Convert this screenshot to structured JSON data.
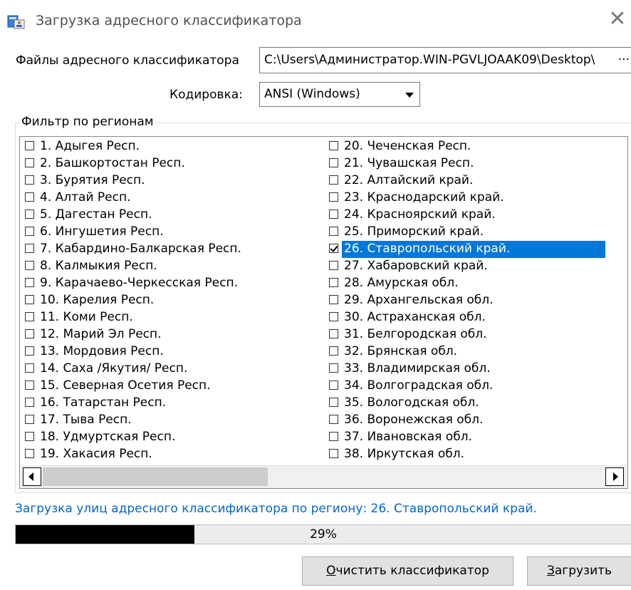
{
  "window": {
    "title": "Загрузка адресного классификатора"
  },
  "files": {
    "label": "Файлы адресного классификатора",
    "path_value": "C:\\Users\\Администратор.WIN-PGVLJOAAK09\\Desktop\\",
    "browse_label": "···"
  },
  "encoding": {
    "label": "Кодировка:",
    "value": "ANSI (Windows)"
  },
  "regions": {
    "legend": "Фильтр по регионам",
    "col1": [
      {
        "label": "1. Адыгея Респ.",
        "checked": false
      },
      {
        "label": "2. Башкортостан Респ.",
        "checked": false
      },
      {
        "label": "3. Бурятия Респ.",
        "checked": false
      },
      {
        "label": "4. Алтай Респ.",
        "checked": false
      },
      {
        "label": "5. Дагестан Респ.",
        "checked": false
      },
      {
        "label": "6. Ингушетия Респ.",
        "checked": false
      },
      {
        "label": "7. Кабардино-Балкарская Респ.",
        "checked": false
      },
      {
        "label": "8. Калмыкия Респ.",
        "checked": false
      },
      {
        "label": "9. Карачаево-Черкесская Респ.",
        "checked": false
      },
      {
        "label": "10. Карелия Респ.",
        "checked": false
      },
      {
        "label": "11. Коми Респ.",
        "checked": false
      },
      {
        "label": "12. Марий Эл Респ.",
        "checked": false
      },
      {
        "label": "13. Мордовия Респ.",
        "checked": false
      },
      {
        "label": "14. Саха /Якутия/ Респ.",
        "checked": false
      },
      {
        "label": "15. Северная Осетия Респ.",
        "checked": false
      },
      {
        "label": "16. Татарстан Респ.",
        "checked": false
      },
      {
        "label": "17. Тыва Респ.",
        "checked": false
      },
      {
        "label": "18. Удмуртская Респ.",
        "checked": false
      },
      {
        "label": "19. Хакасия Респ.",
        "checked": false
      }
    ],
    "col2": [
      {
        "label": "20. Чеченская Респ.",
        "checked": false
      },
      {
        "label": "21. Чувашская Респ.",
        "checked": false
      },
      {
        "label": "22. Алтайский край.",
        "checked": false
      },
      {
        "label": "23. Краснодарский край.",
        "checked": false
      },
      {
        "label": "24. Красноярский край.",
        "checked": false
      },
      {
        "label": "25. Приморский край.",
        "checked": false
      },
      {
        "label": "26. Ставропольский край.",
        "checked": true,
        "selected": true
      },
      {
        "label": "27. Хабаровский край.",
        "checked": false
      },
      {
        "label": "28. Амурская обл.",
        "checked": false
      },
      {
        "label": "29. Архангельская обл.",
        "checked": false
      },
      {
        "label": "30. Астраханская обл.",
        "checked": false
      },
      {
        "label": "31. Белгородская обл.",
        "checked": false
      },
      {
        "label": "32. Брянская обл.",
        "checked": false
      },
      {
        "label": "33. Владимирская обл.",
        "checked": false
      },
      {
        "label": "34. Волгоградская обл.",
        "checked": false
      },
      {
        "label": "35. Вологодская обл.",
        "checked": false
      },
      {
        "label": "36. Воронежская обл.",
        "checked": false
      },
      {
        "label": "37. Ивановская обл.",
        "checked": false
      },
      {
        "label": "38. Иркутская обл.",
        "checked": false
      }
    ]
  },
  "status": {
    "text": "Загрузка улиц адресного классификатора по региону: 26. Ставропольский край."
  },
  "progress": {
    "percent": 29,
    "label": "29%"
  },
  "buttons": {
    "clear": {
      "mnemonic": "О",
      "rest": "чистить классификатор"
    },
    "load": {
      "mnemonic": "З",
      "rest": "агрузить"
    }
  },
  "icons": {
    "app": "address-book-icon",
    "close": "close-icon",
    "dropdown": "chevron-down-icon"
  },
  "colors": {
    "selection": "#0078d7",
    "status_text": "#0066cc",
    "progress_fill": "#000000"
  }
}
